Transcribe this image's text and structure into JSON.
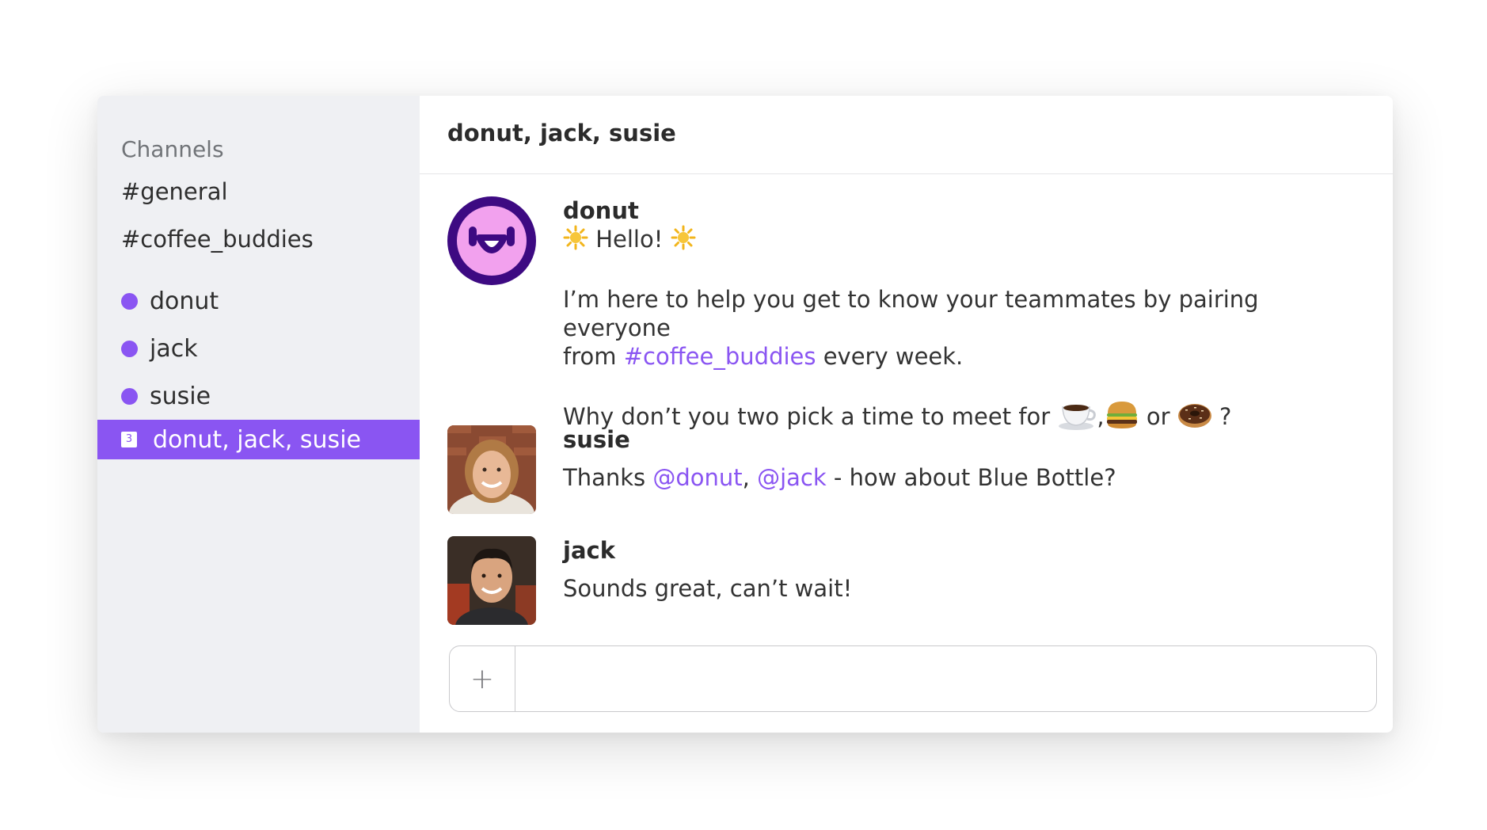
{
  "sidebar": {
    "heading": "Channels",
    "channels": [
      {
        "label": "#general"
      },
      {
        "label": "#coffee_buddies"
      }
    ],
    "direct_messages": [
      {
        "label": "donut"
      },
      {
        "label": "jack"
      },
      {
        "label": "susie"
      }
    ],
    "group": {
      "badge": "3",
      "label": "donut, jack, susie"
    }
  },
  "header": {
    "title": "donut, jack, susie"
  },
  "messages": [
    {
      "sender": "donut",
      "greeting": "Hello!",
      "line1": "I’m here to help you get to know your teammates by pairing everyone",
      "line2_pre": "from ",
      "line2_link": "#coffee_buddies",
      "line2_post": " every week.",
      "line3": "Why don’t you two pick a time to meet for",
      "line3_comma": ",",
      "line3_or": "or",
      "line3_end": "?",
      "icons": [
        "sun-icon",
        "coffee-icon",
        "burger-icon",
        "donut-icon"
      ]
    },
    {
      "sender": "susie",
      "pre": "Thanks ",
      "mention1": "@donut",
      "sep": ", ",
      "mention2": "@jack",
      "post": " - how about Blue Bottle?"
    },
    {
      "sender": "jack",
      "text": "Sounds great, can’t wait!"
    }
  ],
  "composer": {
    "add_label": "+",
    "placeholder": ""
  },
  "colors": {
    "accent": "#8a55f2",
    "sidebar_bg": "#eff0f3",
    "donut_avatar_ring": "#3d0a82",
    "donut_avatar_face": "#f2a1ee"
  }
}
